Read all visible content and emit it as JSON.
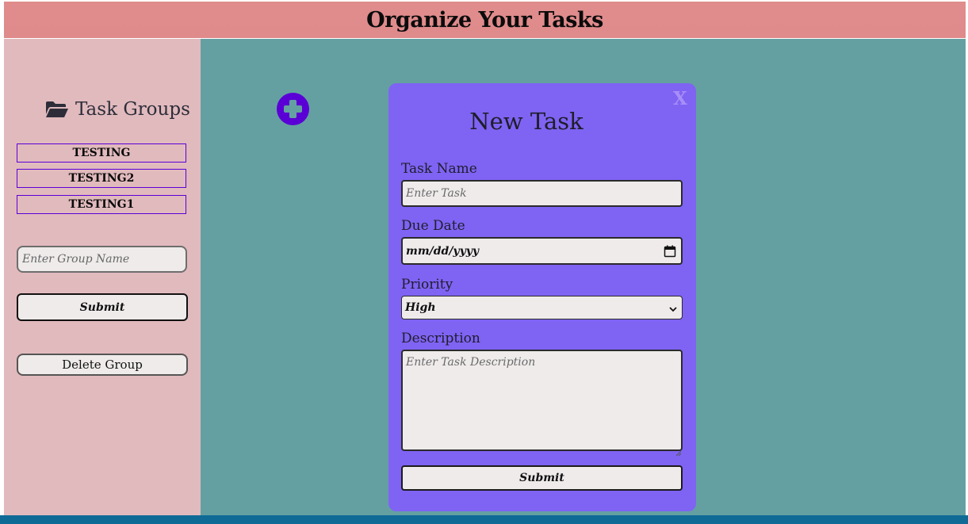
{
  "header": {
    "title": "Organize Your Tasks"
  },
  "sidebar": {
    "title": "Task Groups",
    "title_icon": "folder-open-icon",
    "groups": [
      "TESTING",
      "TESTING2",
      "TESTING1"
    ],
    "group_input_placeholder": "Enter Group Name",
    "submit_label": "Submit",
    "delete_label": "Delete Group"
  },
  "main": {
    "add_icon": "plus-circle-icon"
  },
  "modal": {
    "close_label": "X",
    "title": "New Task",
    "task_name_label": "Task Name",
    "task_name_placeholder": "Enter Task",
    "due_date_label": "Due Date",
    "due_date_value": "mm/dd/yyyy",
    "priority_label": "Priority",
    "priority_value": "High",
    "description_label": "Description",
    "description_placeholder": "Enter Task Description",
    "submit_label": "Submit"
  },
  "colors": {
    "header_bg": "#df8a8b",
    "sidebar_bg": "#e1babd",
    "main_bg": "#64a0a1",
    "modal_bg": "#7f63f3",
    "accent": "#5a00d6"
  }
}
